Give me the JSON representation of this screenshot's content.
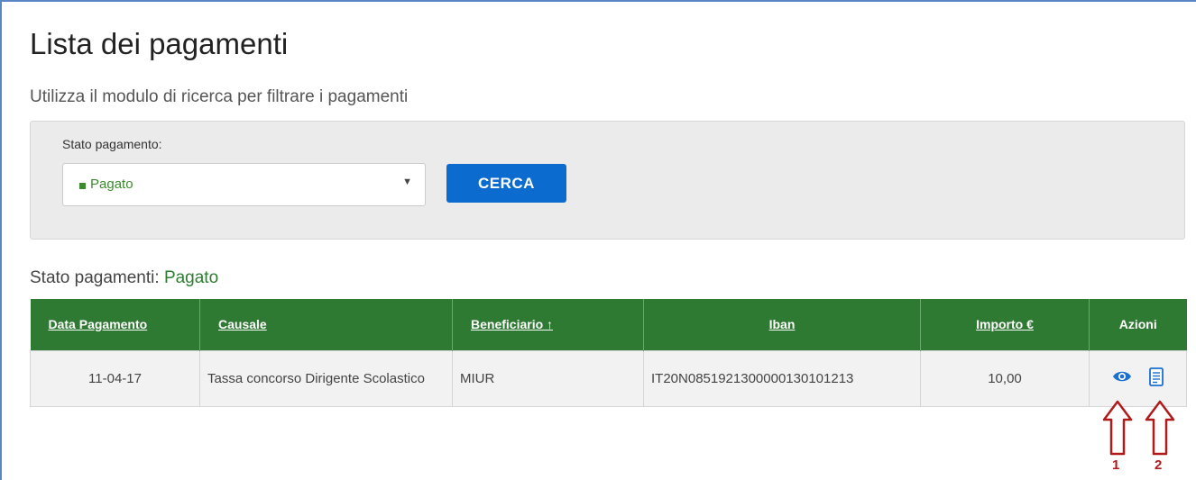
{
  "page": {
    "title": "Lista dei pagamenti",
    "subtitle": "Utilizza il modulo di ricerca per filtrare i pagamenti"
  },
  "search": {
    "label": "Stato pagamento:",
    "selected_value": "Pagato",
    "selected_color": "#3c8a2e",
    "button_label": "CERCA",
    "button_color": "#0b6bcf"
  },
  "status": {
    "label": "Stato pagamenti:",
    "value": "Pagato"
  },
  "table": {
    "header_color": "#2f7a32",
    "columns": [
      "Data Pagamento",
      "Causale",
      "Beneficiario ↑",
      "Iban",
      "Importo €",
      "Azioni"
    ],
    "rows": [
      {
        "data": "11-04-17",
        "causale": "Tassa concorso Dirigente Scolastico",
        "beneficiario": "MIUR",
        "iban": "IT20N0851921300000130101213",
        "importo": "10,00",
        "actions": [
          "eye-icon",
          "document-icon"
        ]
      }
    ]
  },
  "annotations": [
    {
      "number": "1",
      "points_to": "eye-icon",
      "color": "#b01a1a"
    },
    {
      "number": "2",
      "points_to": "document-icon",
      "color": "#b01a1a"
    }
  ]
}
